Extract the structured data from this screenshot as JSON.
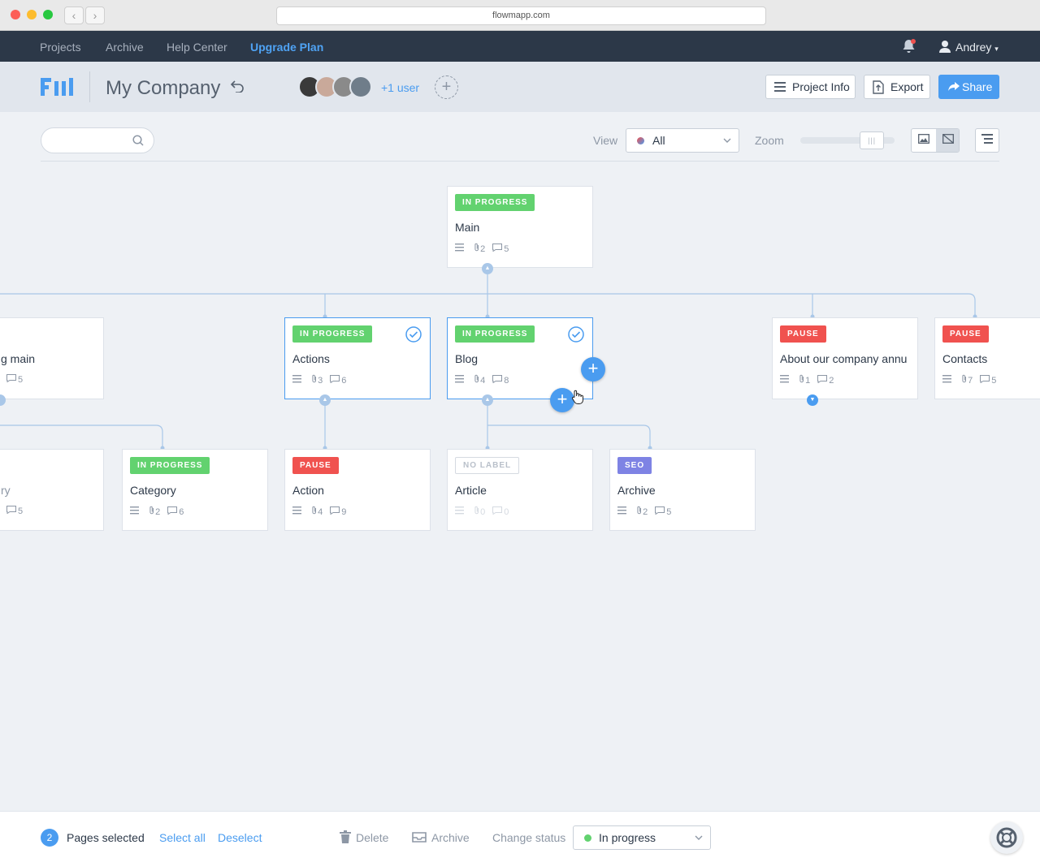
{
  "browser": {
    "url": "flowmapp.com"
  },
  "topnav": {
    "projects": "Projects",
    "archive": "Archive",
    "help": "Help Center",
    "upgrade": "Upgrade Plan",
    "user": "Andrey"
  },
  "header": {
    "title": "My Company",
    "users_more": "+1 user",
    "project_info": "Project Info",
    "export": "Export",
    "share": "Share"
  },
  "toolbar": {
    "view_label": "View",
    "view_value": "All",
    "zoom_label": "Zoom",
    "zoom_level": 0.85
  },
  "cards": [
    {
      "status": "IN PROGRESS",
      "title": "Main",
      "attachments": "2",
      "comments": "5"
    },
    {
      "status": "",
      "title": "g main",
      "attachments": "",
      "comments": "5"
    },
    {
      "status": "IN PROGRESS",
      "title": "Actions",
      "attachments": "3",
      "comments": "6"
    },
    {
      "status": "IN PROGRESS",
      "title": "Blog",
      "attachments": "4",
      "comments": "8"
    },
    {
      "status": "PAUSE",
      "title": "About our company annu",
      "attachments": "1",
      "comments": "2"
    },
    {
      "status": "PAUSE",
      "title": "Contacts",
      "attachments": "7",
      "comments": "5"
    },
    {
      "status": "",
      "title": "ry",
      "attachments": "",
      "comments": "5"
    },
    {
      "status": "IN PROGRESS",
      "title": "Category",
      "attachments": "2",
      "comments": "6"
    },
    {
      "status": "PAUSE",
      "title": "Action",
      "attachments": "4",
      "comments": "9"
    },
    {
      "status": "NO LABEL",
      "title": "Article",
      "attachments": "0",
      "comments": "0"
    },
    {
      "status": "SEO",
      "title": "Archive",
      "attachments": "2",
      "comments": "5"
    }
  ],
  "bottombar": {
    "selected_count": "2",
    "selected_label": "Pages selected",
    "select_all": "Select all",
    "deselect": "Deselect",
    "delete": "Delete",
    "archive": "Archive",
    "change_status": "Change status",
    "status_value": "In progress"
  },
  "colors": {
    "accent": "#4a9cf0",
    "in_progress": "#62d26f",
    "pause": "#f0524f",
    "seo": "#7e83e4",
    "nav": "#2c3848"
  }
}
